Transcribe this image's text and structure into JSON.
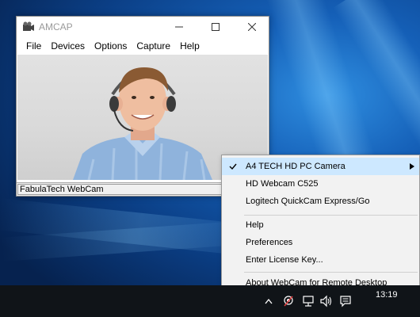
{
  "window": {
    "title": "AMCAP",
    "menu": [
      "File",
      "Devices",
      "Options",
      "Capture",
      "Help"
    ],
    "status_text": "FabulaTech WebCam"
  },
  "context_menu": {
    "items": [
      {
        "label": "A4 TECH HD PC Camera",
        "checked": true,
        "submenu": true
      },
      {
        "label": "HD Webcam C525"
      },
      {
        "label": "Logitech QuickCam Express/Go"
      },
      {
        "label": "Help"
      },
      {
        "label": "Preferences"
      },
      {
        "label": "Enter License Key..."
      },
      {
        "label": "About WebCam for Remote Desktop"
      }
    ]
  },
  "taskbar": {
    "clock": "13:19",
    "tray_icons": [
      "chevron-up-icon",
      "webcam-tray-icon",
      "network-icon",
      "volume-icon",
      "action-center-icon"
    ]
  },
  "colors": {
    "menu_highlight": "#cde8ff",
    "taskbar": "#101418",
    "wallpaper": "#1560b8"
  }
}
